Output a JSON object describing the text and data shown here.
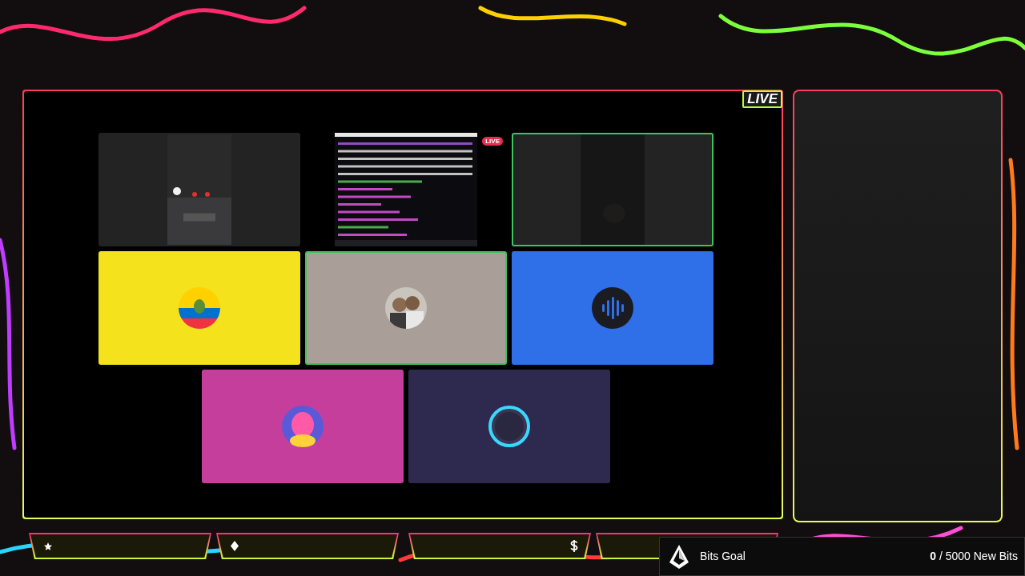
{
  "live_badge": "LIVE",
  "participants": [
    {
      "kind": "video",
      "speaking": false
    },
    {
      "kind": "screen",
      "badge": "LIVE"
    },
    {
      "kind": "video",
      "speaking": true
    },
    {
      "kind": "avatar",
      "avatar": {
        "kind": "flag"
      },
      "color": "#f3e21c",
      "speaking": false
    },
    {
      "kind": "avatar",
      "color": "#a99f98",
      "speaking": true
    },
    {
      "kind": "avatar",
      "avatar": {
        "kind": "waves"
      },
      "color": "#2f6fe8",
      "speaking": false
    },
    {
      "kind": "avatar",
      "avatar": {
        "kind": "character"
      },
      "color": "#c63e9c",
      "speaking": false
    },
    {
      "kind": "avatar",
      "avatar": {
        "kind": "ring"
      },
      "color": "#2e2a4f",
      "speaking": false
    }
  ],
  "goal_bars": [
    {
      "kind": "star"
    },
    {
      "kind": "diamond"
    },
    {
      "kind": "dollar"
    },
    {
      "kind": "empty"
    }
  ],
  "bits_goal": {
    "title": "Bits Goal",
    "current": "0",
    "target": "/ 5000 New Bits",
    "level": 0
  }
}
